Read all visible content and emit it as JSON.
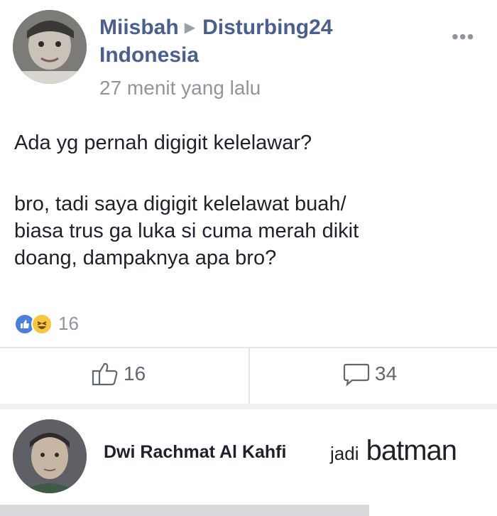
{
  "post": {
    "author": "Miisbah",
    "group": "Disturbing24",
    "group_line2": "Indonesia",
    "time": "27 menit yang lalu",
    "text_line1": "Ada yg pernah digigit kelelawar?",
    "text_line2": "bro, tadi saya digigit kelelawat buah/",
    "text_line3": "biasa trus ga luka si cuma merah dikit",
    "text_line4": "doang, dampaknya apa bro?",
    "reaction_count": "16",
    "like_count": "16",
    "comment_count": "34",
    "more_label": "•••"
  },
  "comment": {
    "author": "Dwi Rachmat Al Kahfi",
    "text_prefix": "jadi",
    "text_main": "batman"
  },
  "colors": {
    "name_blue": "#4b5f8f",
    "meta_gray": "#90949c",
    "like_blue": "#4a7fdc",
    "haha_yellow": "#f7c63d"
  },
  "icons": [
    "arrow-right-icon",
    "more-icon",
    "like-reaction-icon",
    "haha-reaction-icon",
    "thumbs-up-icon",
    "comment-bubble-icon"
  ]
}
